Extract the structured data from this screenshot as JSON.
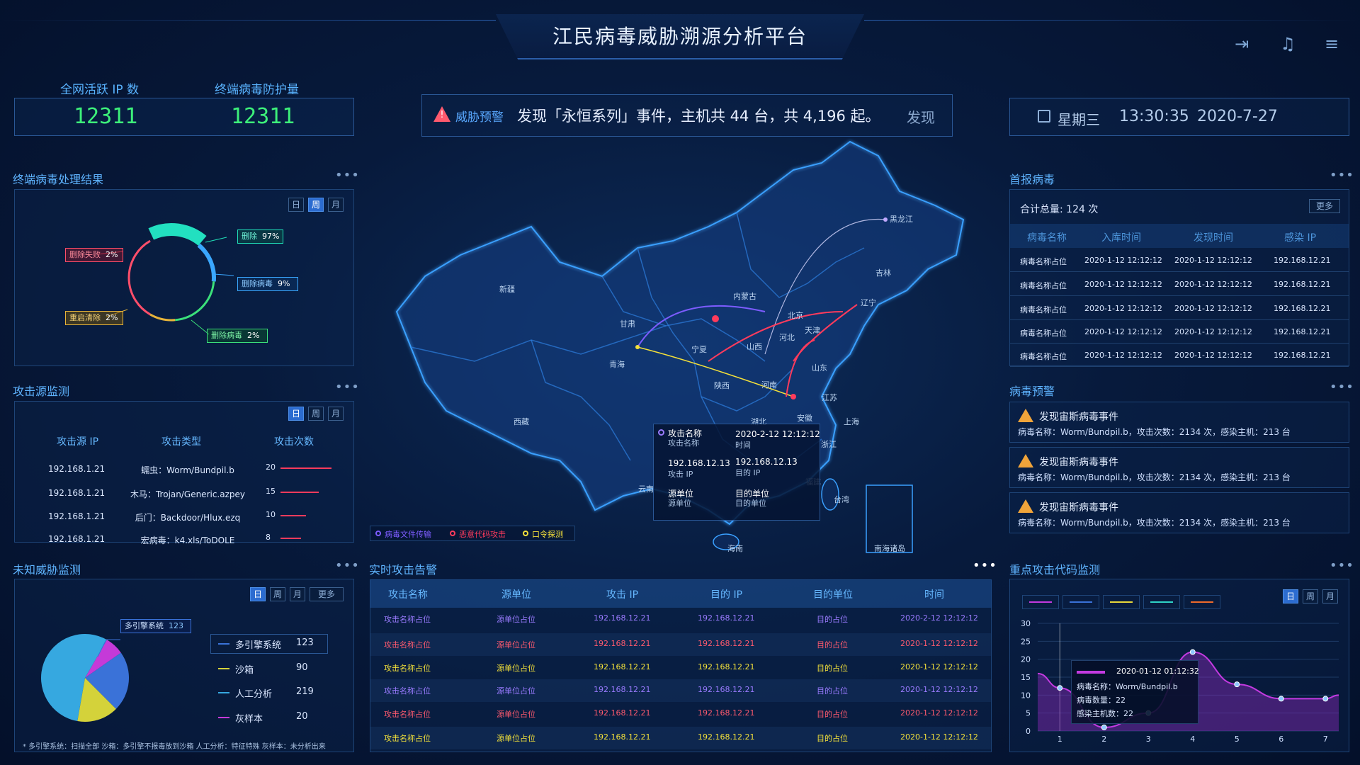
{
  "title": "江民病毒威胁溯源分析平台",
  "stats": [
    {
      "label": "全网活跃 IP 数",
      "value": "12311"
    },
    {
      "label": "终端病毒防护量",
      "value": "12311"
    }
  ],
  "ticker": {
    "tag": "威胁预警",
    "text": "发现「永恒系列」事件，主机共 44 台，共 4,196 起。",
    "tail": "发现"
  },
  "clock": {
    "weekday": "星期三",
    "time": "13:30:35",
    "date": "2020-7-27"
  },
  "toolbar_icons": [
    "logout-icon",
    "music-icon",
    "menu-icon"
  ],
  "left": {
    "virus_result": {
      "title": "终端病毒处理结果",
      "tabs": [
        "日",
        "周",
        "月"
      ],
      "active_tab": "周",
      "labels": [
        {
          "text": "删除失败",
          "pct": "2%",
          "color": "#ff4e6a"
        },
        {
          "text": "删除",
          "pct": "97%",
          "color": "#20e0b8"
        },
        {
          "text": "删除病毒",
          "pct": "9%",
          "color": "#3aa7ff"
        },
        {
          "text": "重启清除",
          "pct": "2%",
          "color": "#e6b43a"
        },
        {
          "text": "删除病毒",
          "pct": "2%",
          "color": "#3be07a"
        }
      ],
      "donut": [
        {
          "name": "删除",
          "value": 97,
          "color": "#22e0c0"
        },
        {
          "name": "删除病毒",
          "value": 9,
          "color": "#3aa7ff"
        },
        {
          "name": "删除病毒2",
          "value": 2,
          "color": "#3be07a"
        },
        {
          "name": "重启清除",
          "value": 2,
          "color": "#e6b43a"
        },
        {
          "name": "删除失败",
          "value": 2,
          "color": "#ff4e6a"
        }
      ]
    },
    "attack_source": {
      "title": "攻击源监测",
      "tabs": [
        "日",
        "周",
        "月"
      ],
      "active_tab": "日",
      "headers": [
        "攻击源 IP",
        "攻击类型",
        "攻击次数"
      ],
      "rows": [
        {
          "ip": "192.168.1.21",
          "type": "蠕虫：Worm/Bundpil.b",
          "count": 20
        },
        {
          "ip": "192.168.1.21",
          "type": "木马：Trojan/Generic.azpey",
          "count": 15
        },
        {
          "ip": "192.168.1.21",
          "type": "后门：Backdoor/Hlux.ezq",
          "count": 10
        },
        {
          "ip": "192.168.1.21",
          "type": "宏病毒：k4.xls/ToDOLE",
          "count": 8
        }
      ],
      "bar_max": 20
    },
    "unknown_threat": {
      "title": "未知威胁监测",
      "tabs": [
        "日",
        "周",
        "月",
        "更多"
      ],
      "active_tab": "日",
      "callout": {
        "name": "多引擎系统",
        "value": "123"
      },
      "legend": [
        {
          "name": "多引擎系统",
          "value": "123",
          "color": "#3a72d8"
        },
        {
          "name": "沙箱",
          "value": "90",
          "color": "#d4d23a"
        },
        {
          "name": "人工分析",
          "value": "219",
          "color": "#36a8e0"
        },
        {
          "name": "灰样本",
          "value": "20",
          "color": "#c53ad8"
        }
      ],
      "footnote": "* 多引擎系统：扫描全部 沙箱：多引擎不报毒放到沙箱 人工分析：特征特殊 灰样本：未分析出来"
    }
  },
  "map": {
    "provinces": [
      {
        "name": "黑龙江"
      },
      {
        "name": "吉林"
      },
      {
        "name": "辽宁"
      },
      {
        "name": "内蒙古"
      },
      {
        "name": "新疆"
      },
      {
        "name": "甘肃"
      },
      {
        "name": "宁夏"
      },
      {
        "name": "山西"
      },
      {
        "name": "河北"
      },
      {
        "name": "北京"
      },
      {
        "name": "天津"
      },
      {
        "name": "山东"
      },
      {
        "name": "青海"
      },
      {
        "name": "陕西"
      },
      {
        "name": "河南"
      },
      {
        "name": "江苏"
      },
      {
        "name": "西藏"
      },
      {
        "name": "湖北"
      },
      {
        "name": "安徽"
      },
      {
        "name": "上海"
      },
      {
        "name": "浙江"
      },
      {
        "name": "云南"
      },
      {
        "name": "福建"
      },
      {
        "name": "台湾"
      },
      {
        "name": "海南"
      },
      {
        "name": "南海诸岛"
      }
    ],
    "tooltip": {
      "attack_name": "攻击名称",
      "attack_name_label": "攻击名称",
      "time": "2020-2-12  12:12:12",
      "time_label": "时间",
      "attack_ip": "192.168.12.13",
      "attack_ip_label": "攻击 IP",
      "dest_ip": "192.168.12.13",
      "dest_ip_label": "目的 IP",
      "src_unit": "源单位",
      "src_unit_label": "源单位",
      "dst_unit": "目的单位",
      "dst_unit_label": "目的单位"
    },
    "legend": [
      {
        "name": "病毒文件传输",
        "color": "#7d5cff"
      },
      {
        "name": "恶意代码攻击",
        "color": "#ff3b5c"
      },
      {
        "name": "口令探测",
        "color": "#f4e03a"
      }
    ]
  },
  "alerts": {
    "title": "实时攻击告警",
    "headers": [
      "攻击名称",
      "源单位",
      "攻击 IP",
      "目的 IP",
      "目的单位",
      "时间"
    ],
    "rows": [
      {
        "name": "攻击名称占位",
        "src": "源单位占位",
        "aip": "192.168.12.21",
        "dip": "192.168.12.21",
        "dst": "目的占位",
        "time": "2020-2-12  12:12:12",
        "color": "#9a7bff"
      },
      {
        "name": "攻击名称占位",
        "src": "源单位占位",
        "aip": "192.168.12.21",
        "dip": "192.168.12.21",
        "dst": "目的占位",
        "time": "2020-1-12  12:12:12",
        "color": "#ff5a6e"
      },
      {
        "name": "攻击名称占位",
        "src": "源单位占位",
        "aip": "192.168.12.21",
        "dip": "192.168.12.21",
        "dst": "目的占位",
        "time": "2020-1-12  12:12:12",
        "color": "#f2e03a"
      },
      {
        "name": "攻击名称占位",
        "src": "源单位占位",
        "aip": "192.168.12.21",
        "dip": "192.168.12.21",
        "dst": "目的占位",
        "time": "2020-1-12  12:12:12",
        "color": "#9a7bff"
      },
      {
        "name": "攻击名称占位",
        "src": "源单位占位",
        "aip": "192.168.12.21",
        "dip": "192.168.12.21",
        "dst": "目的占位",
        "time": "2020-1-12  12:12:12",
        "color": "#ff5a6e"
      },
      {
        "name": "攻击名称占位",
        "src": "源单位占位",
        "aip": "192.168.12.21",
        "dip": "192.168.12.21",
        "dst": "目的占位",
        "time": "2020-1-12  12:12:12",
        "color": "#f2e03a"
      }
    ]
  },
  "right": {
    "first_report": {
      "title": "首报病毒",
      "total": "合计总量: 124 次",
      "more": "更多",
      "headers": [
        "病毒名称",
        "入库时间",
        "发现时间",
        "感染 IP"
      ],
      "rows": [
        [
          "病毒名称占位",
          "2020-1-12  12:12:12",
          "2020-1-12  12:12:12",
          "192.168.12.21"
        ],
        [
          "病毒名称占位",
          "2020-1-12  12:12:12",
          "2020-1-12  12:12:12",
          "192.168.12.21"
        ],
        [
          "病毒名称占位",
          "2020-1-12  12:12:12",
          "2020-1-12  12:12:12",
          "192.168.12.21"
        ],
        [
          "病毒名称占位",
          "2020-1-12  12:12:12",
          "2020-1-12  12:12:12",
          "192.168.12.21"
        ],
        [
          "病毒名称占位",
          "2020-1-12  12:12:12",
          "2020-1-12  12:12:12",
          "192.168.12.21"
        ]
      ]
    },
    "virus_warn": {
      "title": "病毒预警",
      "items": [
        {
          "title": "发现宙斯病毒事件",
          "detail": "病毒名称：Worm/Bundpil.b，攻击次数：2134 次，感染主机：213 台"
        },
        {
          "title": "发现宙斯病毒事件",
          "detail": "病毒名称：Worm/Bundpil.b，攻击次数：2134 次，感染主机：213 台"
        },
        {
          "title": "发现宙斯病毒事件",
          "detail": "病毒名称：Worm/Bundpil.b，攻击次数：2134 次，感染主机：213 台"
        }
      ]
    },
    "key_code": {
      "title": "重点攻击代码监测",
      "tabs": [
        "日",
        "周",
        "月"
      ],
      "active_tab": "日",
      "series_colors": [
        "#c33ae0",
        "#3a72d8",
        "#e8d83a",
        "#2fd3c6",
        "#ef6a2a"
      ],
      "tooltip": {
        "time": "2020-01-12  01:12:32",
        "name": "病毒名称：Worm/Bundpil.b",
        "count": "病毒数量：22",
        "hosts": "感染主机数：22"
      }
    }
  },
  "chart_data": {
    "type": "area",
    "x": [
      1,
      2,
      3,
      4,
      5,
      6,
      7
    ],
    "xlim": [
      0.5,
      7.3
    ],
    "ylim": [
      0,
      30
    ],
    "yticks": [
      0,
      5,
      10,
      15,
      20,
      25,
      30
    ],
    "series": [
      {
        "values": [
          12,
          1,
          5,
          22,
          13,
          9,
          9
        ]
      }
    ]
  }
}
